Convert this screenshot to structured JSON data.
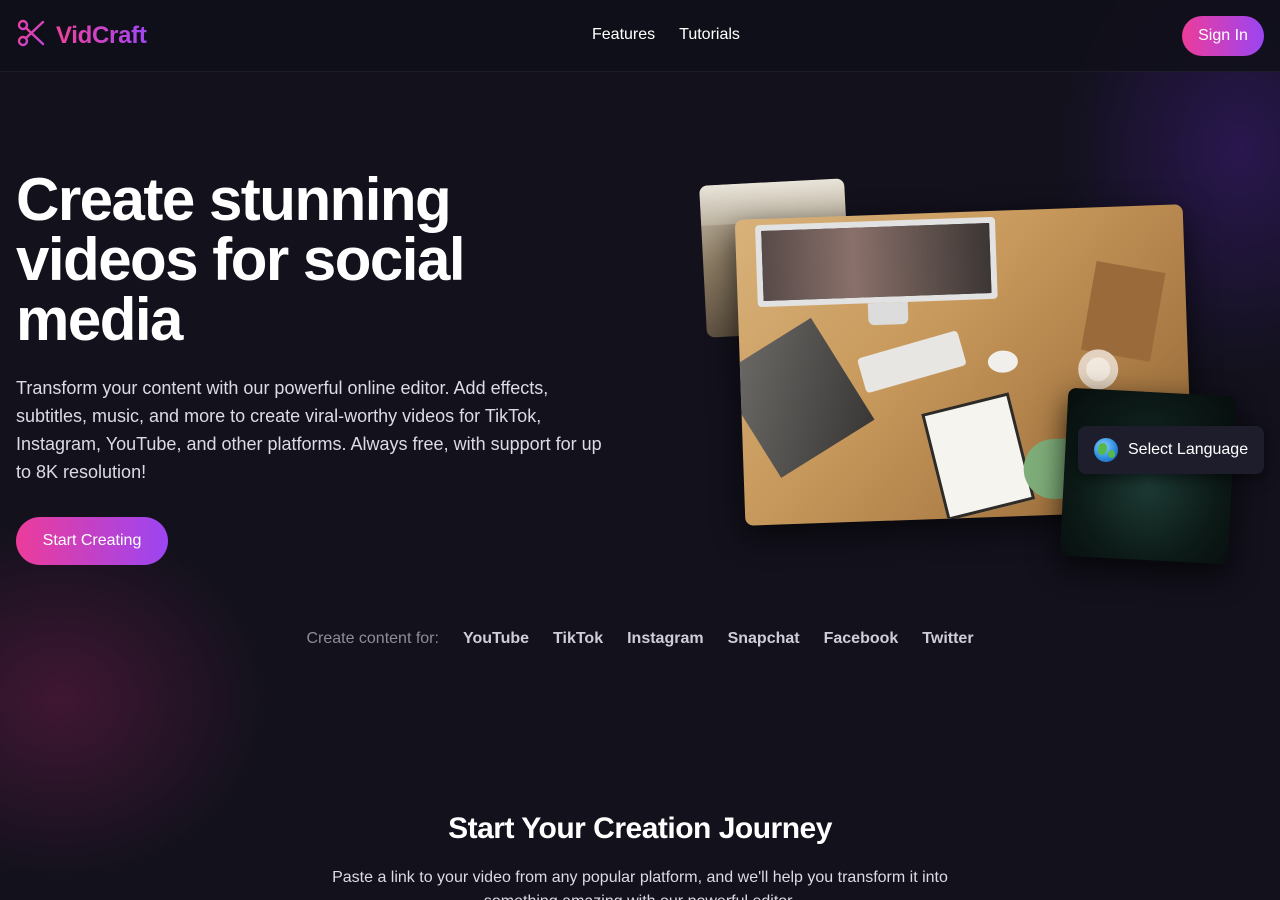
{
  "header": {
    "brand": "VidCraft",
    "logo_icon": "scissors-icon",
    "nav": [
      {
        "label": "Features"
      },
      {
        "label": "Tutorials"
      }
    ],
    "signin_label": "Sign In"
  },
  "hero": {
    "title": "Create stunning videos for social media",
    "description": "Transform your content with our powerful online editor. Add effects, subtitles, music, and more to create viral-worthy videos for TikTok, Instagram, YouTube, and other platforms. Always free, with support for up to 8K resolution!",
    "cta_label": "Start Creating"
  },
  "language": {
    "icon": "globe-icon",
    "label": "Select Language"
  },
  "platforms": {
    "label": "Create content for:",
    "items": [
      "YouTube",
      "TikTok",
      "Instagram",
      "Snapchat",
      "Facebook",
      "Twitter"
    ]
  },
  "journey": {
    "title": "Start Your Creation Journey",
    "description": "Paste a link to your video from any popular platform, and we'll help you transform it into something amazing with our powerful editor."
  },
  "colors": {
    "background": "#12111c",
    "accent_pink": "#ec3c9a",
    "accent_purple": "#9b45f2"
  }
}
